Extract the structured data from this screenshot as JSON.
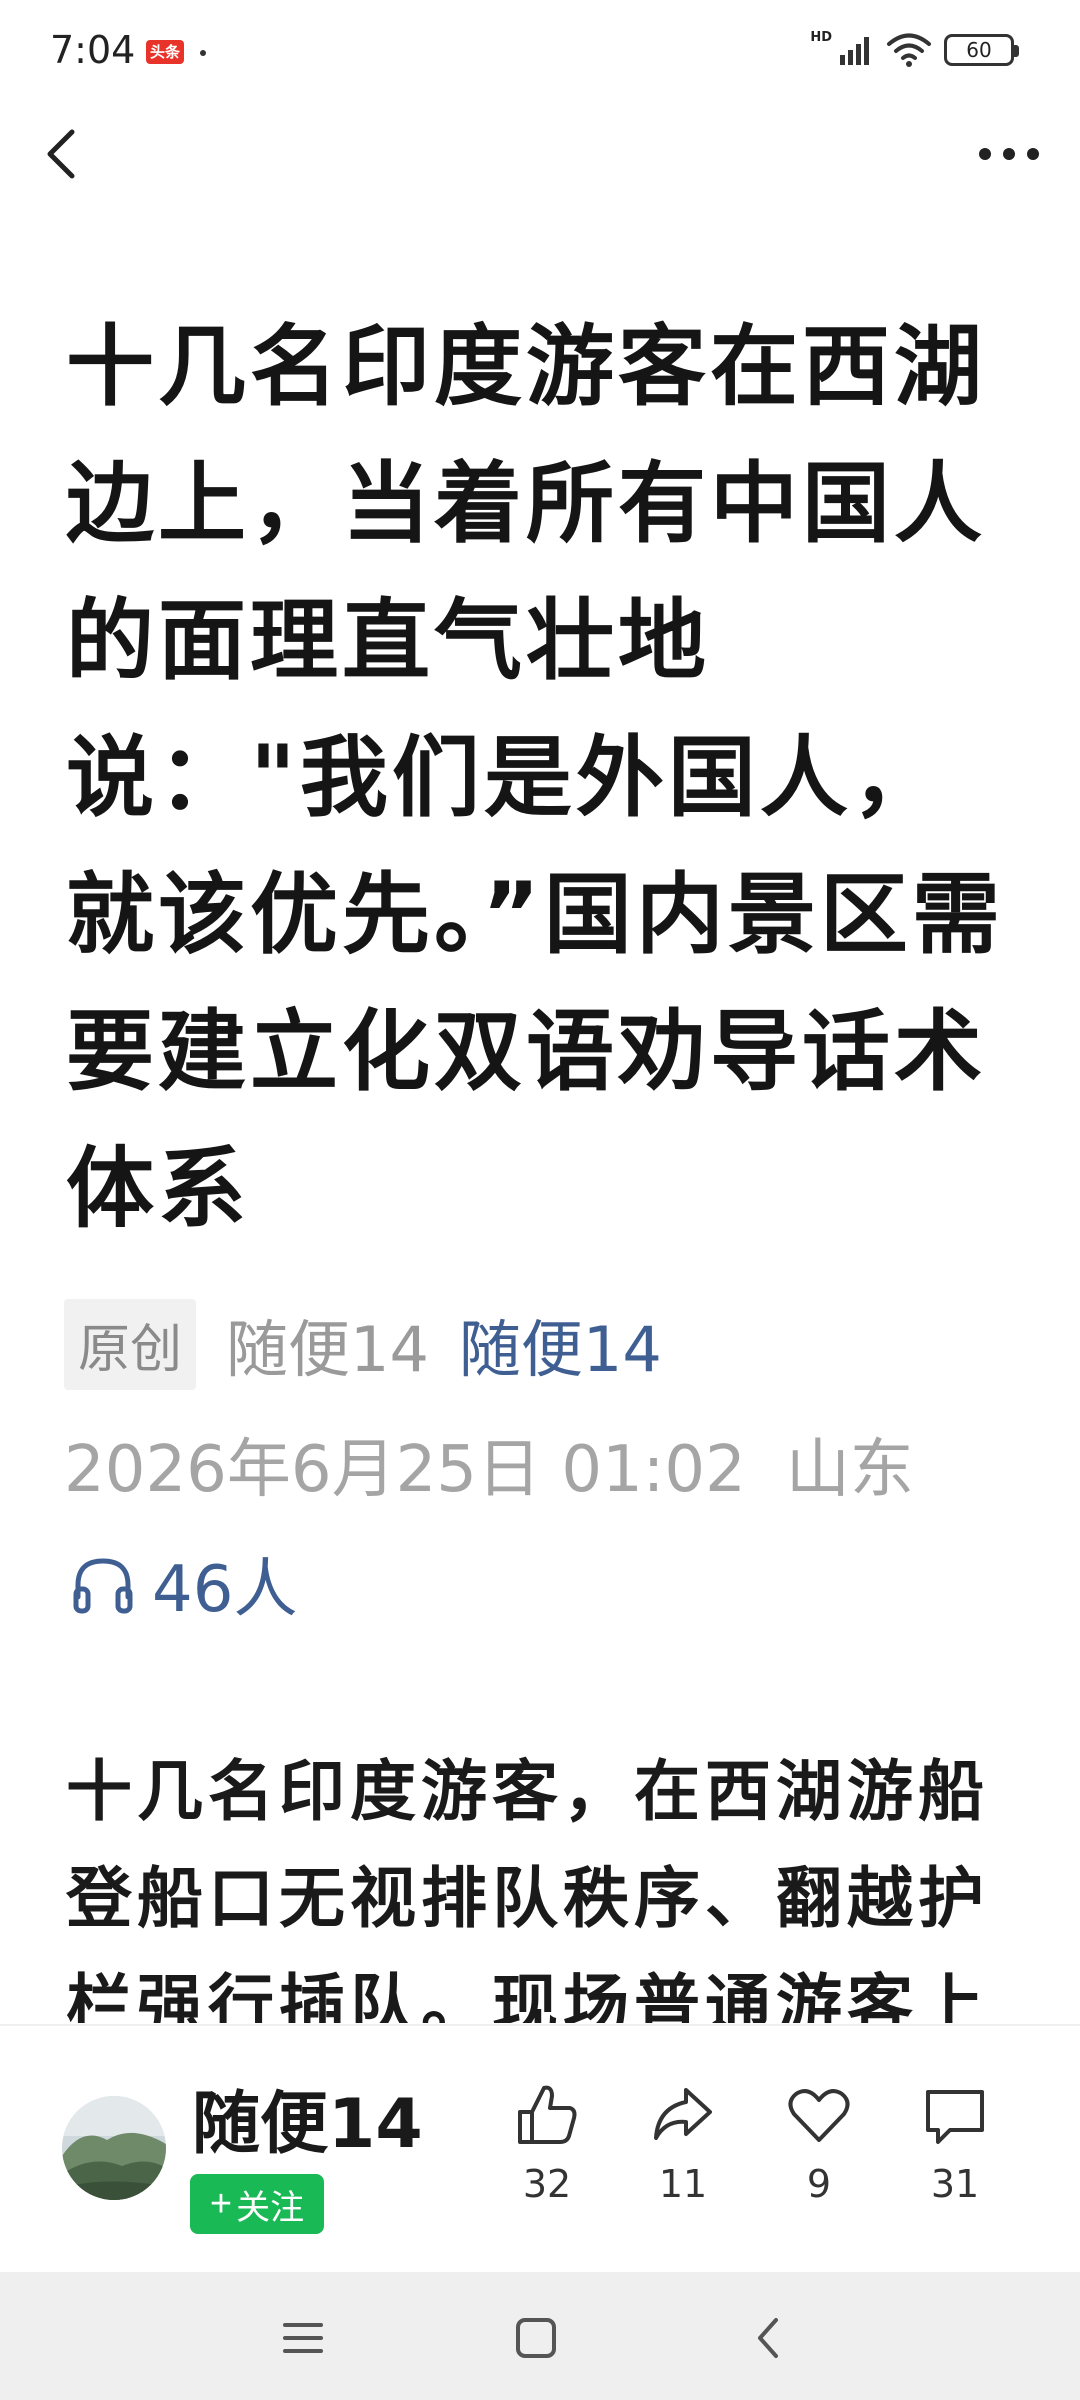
{
  "status_bar": {
    "time": "7:04",
    "app_badge": "头条",
    "network_label": "HD",
    "battery": "60"
  },
  "article": {
    "title": "十几名印度游客在西湖边上，当着所有中国人的面理直气壮地说：\"我们是外国人，就该优先。”国内景区需要建立化双语劝导话术体系",
    "original_tag": "原创",
    "source_name": "随便14",
    "author_link": "随便14",
    "date": "2026年6月25日 01:02",
    "location": "山东",
    "listeners": "46人",
    "body": "十几名印度游客，在西湖游船登船口无视排队秩序、翻越护栏强行插队。现场普通游客上"
  },
  "action_bar": {
    "author_name": "随便14",
    "follow_label": "关注",
    "like_count": "32",
    "share_count": "11",
    "favorite_count": "9",
    "comment_count": "31"
  },
  "colors": {
    "follow_green": "#19b955",
    "link_blue": "#3f5f93",
    "meta_gray": "#a5a5a5"
  },
  "icons": [
    "back-icon",
    "more-icon",
    "headphones-icon",
    "like-icon",
    "share-icon",
    "heart-icon",
    "comment-icon",
    "menu-icon",
    "home-icon",
    "back-nav-icon"
  ]
}
